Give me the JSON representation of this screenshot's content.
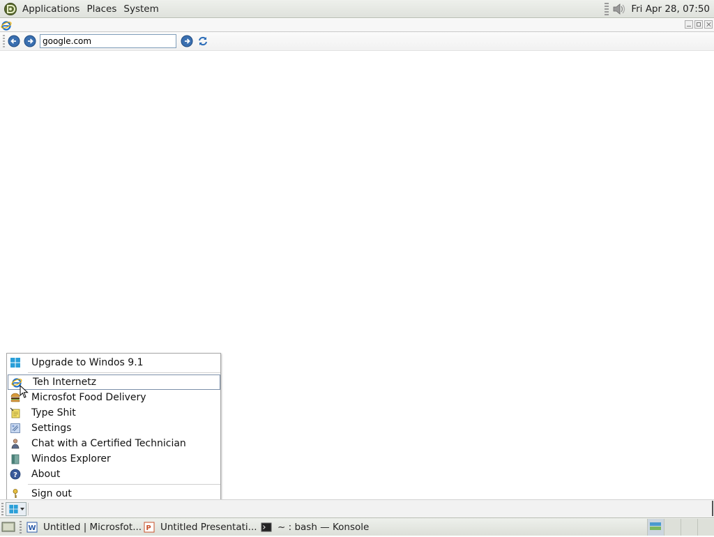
{
  "top_panel": {
    "menus": [
      "Applications",
      "Places",
      "System"
    ],
    "clock": "Fri Apr 28, 07:50",
    "tray_icon": "volume-icon"
  },
  "browser": {
    "address_value": "google.com",
    "buttons": [
      "back-icon",
      "forward-icon",
      "go-icon",
      "refresh-icon"
    ]
  },
  "start_menu": {
    "items": [
      {
        "label": "Upgrade to Windos 9.1",
        "icon": "windows-logo-icon"
      },
      {
        "label": "Teh Internetz",
        "icon": "internet-explorer-icon",
        "selected": true
      },
      {
        "label": "Microsfot Food Delivery",
        "icon": "burger-icon"
      },
      {
        "label": "Type Shit",
        "icon": "notepad-icon"
      },
      {
        "label": "Settings",
        "icon": "settings-icon"
      },
      {
        "label": "Chat with a Certified Technician",
        "icon": "technician-icon"
      },
      {
        "label": "Windos Explorer",
        "icon": "folder-icon"
      },
      {
        "label": "About",
        "icon": "help-icon"
      },
      {
        "label": "Sign out",
        "icon": "key-icon"
      }
    ]
  },
  "taskbar": {
    "tasks": [
      {
        "label": "Untitled | Microsfot...",
        "icon": "word-icon"
      },
      {
        "label": "Untitled Presentati...",
        "icon": "powerpoint-icon"
      },
      {
        "label": "~ : bash — Konsole",
        "icon": "terminal-icon"
      }
    ]
  },
  "colors": {
    "panel_bg": "#e6e9e3",
    "ie_blue": "#1f6fc8",
    "windows_blue": "#2a9fd8",
    "selection_border": "#7a8ea8"
  }
}
